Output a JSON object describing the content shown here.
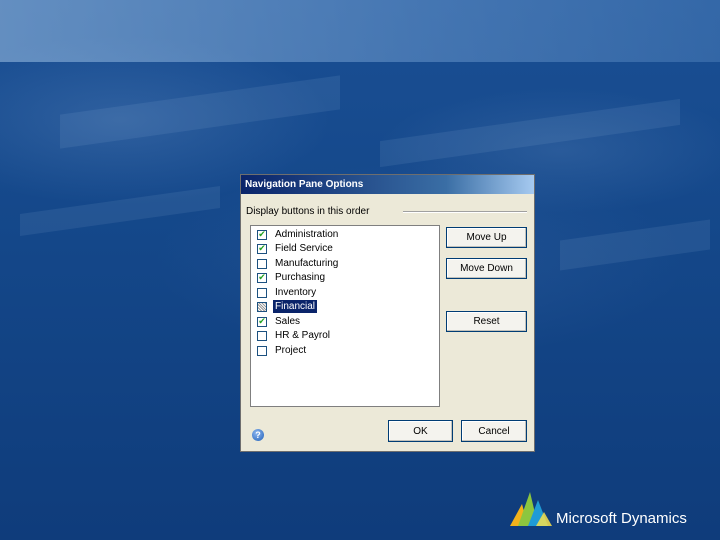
{
  "dialog": {
    "title": "Navigation Pane Options",
    "caption": "Display buttons in this order",
    "items": [
      {
        "label": "Administration",
        "checked": true,
        "state": "checked"
      },
      {
        "label": "Field Service",
        "checked": true,
        "state": "checked"
      },
      {
        "label": "Manufacturing",
        "checked": false,
        "state": "unchecked"
      },
      {
        "label": "Purchasing",
        "checked": true,
        "state": "checked"
      },
      {
        "label": "Inventory",
        "checked": false,
        "state": "unchecked"
      },
      {
        "label": "Financial",
        "checked": false,
        "state": "indeterminate",
        "selected": true
      },
      {
        "label": "Sales",
        "checked": true,
        "state": "checked"
      },
      {
        "label": "HR & Payrol",
        "checked": false,
        "state": "unchecked"
      },
      {
        "label": "Project",
        "checked": false,
        "state": "unchecked"
      }
    ],
    "buttons": {
      "move_up": "Move Up",
      "move_down": "Move Down",
      "reset": "Reset",
      "ok": "OK",
      "cancel": "Cancel"
    },
    "help_icon": "help-icon"
  },
  "branding": {
    "logo_text": "Microsoft Dynamics"
  },
  "colors": {
    "background": "#144789",
    "title_bar": "#0a246a",
    "dialog_face": "#ece9d8",
    "check_mark": "#21a121"
  }
}
